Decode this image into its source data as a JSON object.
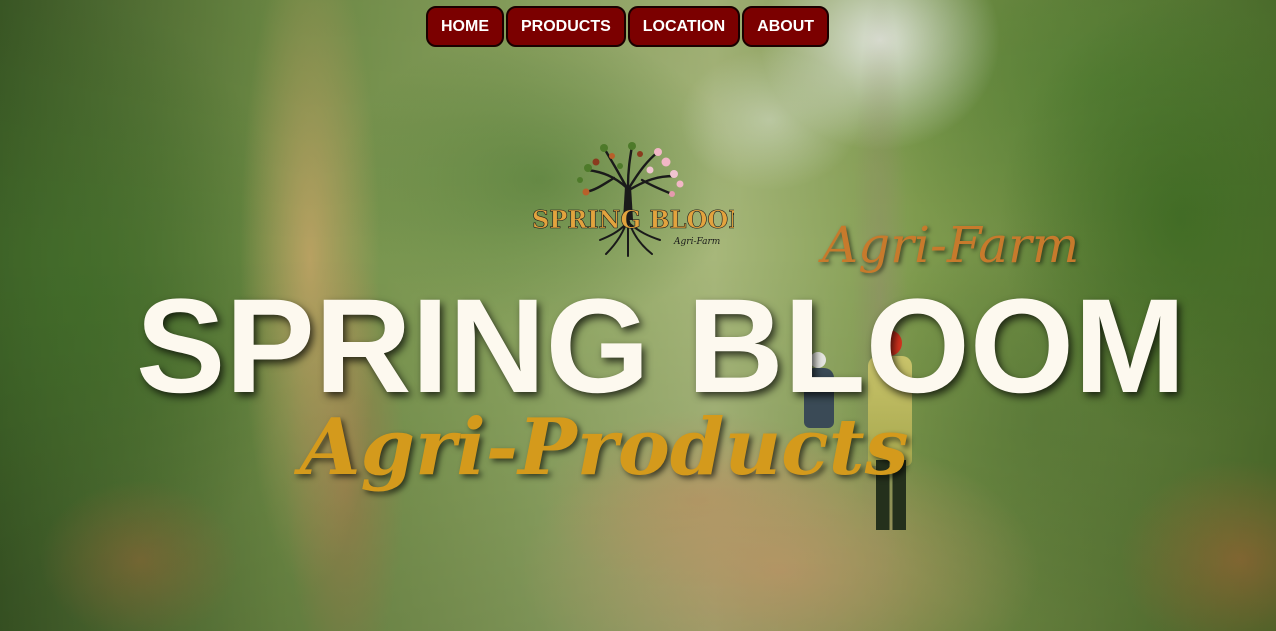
{
  "nav": {
    "items": [
      {
        "label": "HOME"
      },
      {
        "label": "PRODUCTS"
      },
      {
        "label": "LOCATION"
      },
      {
        "label": "ABOUT"
      }
    ],
    "button_color": "#7b0000"
  },
  "logo": {
    "brand_text": "SPRING BLOOM",
    "sub_text": "Agri-Farm"
  },
  "hero": {
    "tagline": "Agri-Farm",
    "title": "SPRING BLOOM",
    "subtitle": "Agri-Products"
  },
  "colors": {
    "title": "#fdf9ef",
    "tagline": "#c77a2c",
    "subtitle": "#d49a1c"
  }
}
